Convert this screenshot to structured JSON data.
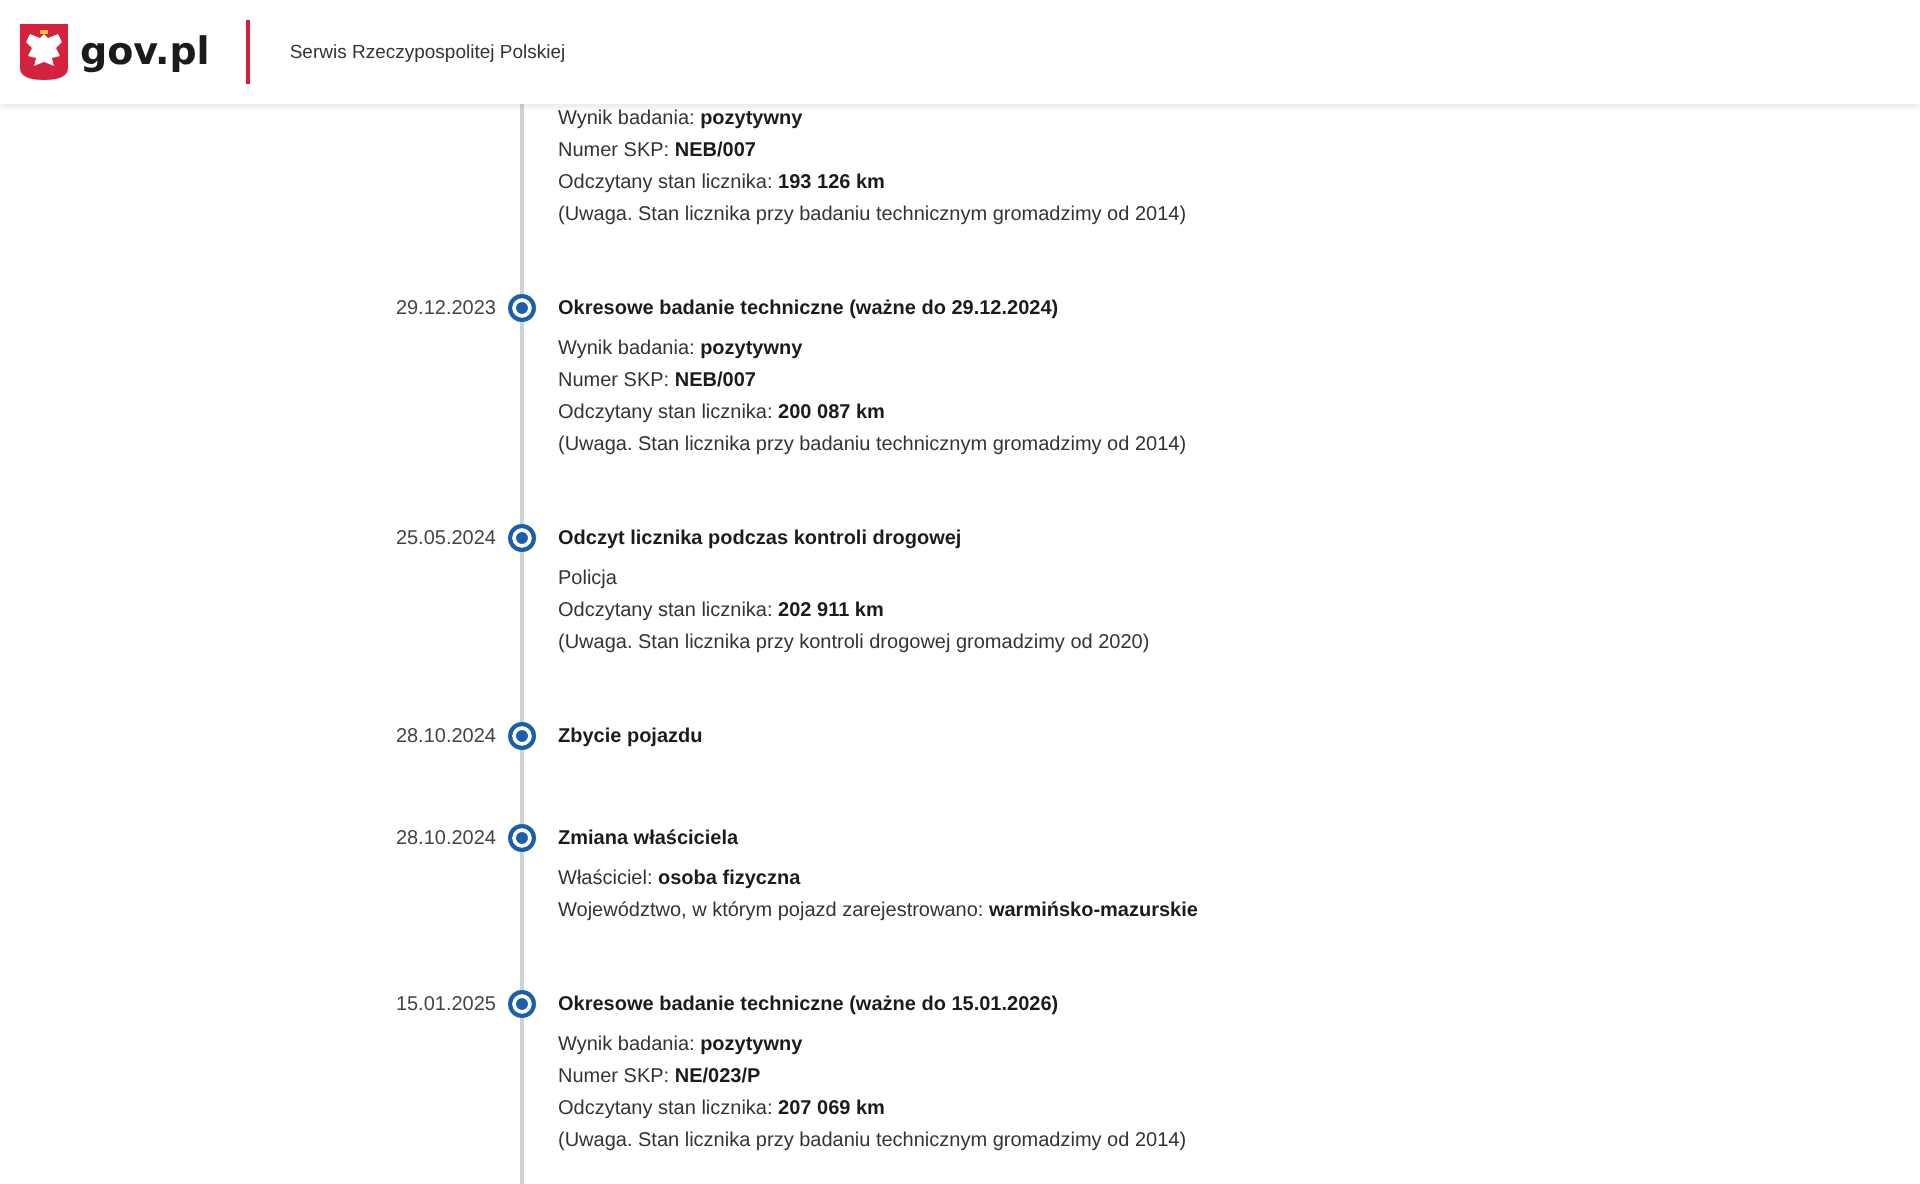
{
  "header": {
    "logo_text": "gov.pl",
    "service": "Serwis Rzeczypospolitej Polskiej"
  },
  "events": [
    {
      "details": [
        "Wynik badania: **pozytywny**",
        "Numer SKP: **NEB/007**",
        "Odczytany stan licznika: **193 126 km**",
        "(Uwaga. Stan licznika przy badaniu technicznym gromadzimy od 2014)"
      ]
    },
    {
      "date": "29.12.2023",
      "title": "Okresowe badanie techniczne (ważne do 29.12.2024)",
      "details": [
        "Wynik badania: **pozytywny**",
        "Numer SKP: **NEB/007**",
        "Odczytany stan licznika: **200 087 km**",
        "(Uwaga. Stan licznika przy badaniu technicznym gromadzimy od 2014)"
      ]
    },
    {
      "date": "25.05.2024",
      "title": "Odczyt licznika podczas kontroli drogowej",
      "details": [
        "Policja",
        "Odczytany stan licznika: **202 911 km**",
        "(Uwaga. Stan licznika przy kontroli drogowej gromadzimy od 2020)"
      ]
    },
    {
      "date": "28.10.2024",
      "title": "Zbycie pojazdu"
    },
    {
      "date": "28.10.2024",
      "title": "Zmiana właściciela",
      "details": [
        "Właściciel: **osoba fizyczna**",
        "Województwo, w którym pojazd zarejestrowano: **warmińsko-mazurskie**"
      ]
    },
    {
      "date": "15.01.2025",
      "title": "Okresowe badanie techniczne (ważne do 15.01.2026)",
      "details": [
        "Wynik badania: **pozytywny**",
        "Numer SKP: **NE/023/P**",
        "Odczytany stan licznika: **207 069 km**",
        "(Uwaga. Stan licznika przy badaniu technicznym gromadzimy od 2014)"
      ]
    }
  ]
}
